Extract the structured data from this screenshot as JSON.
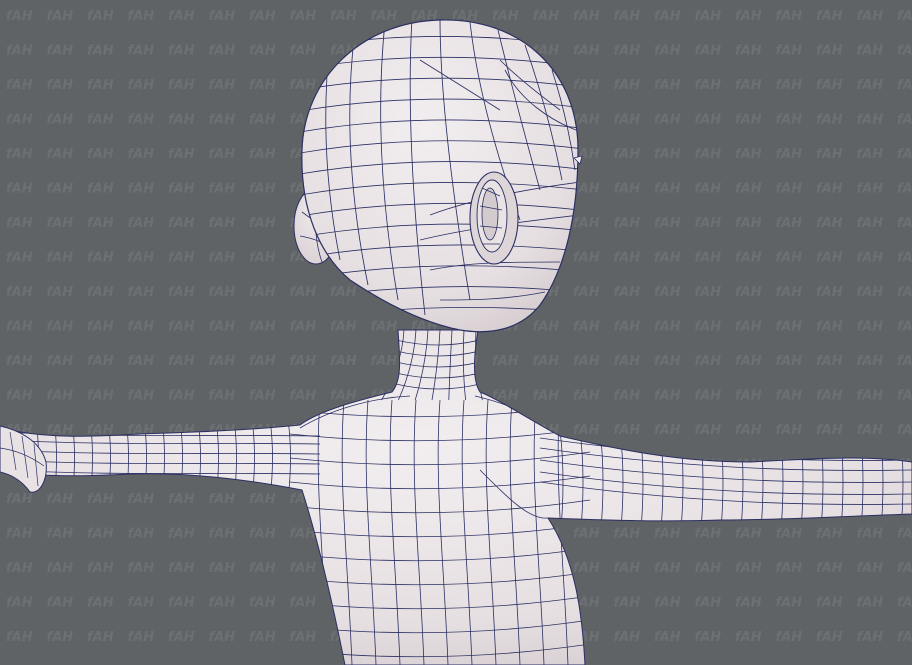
{
  "viewport": {
    "background": "#5f6366",
    "mesh_fill": "#ece6e8",
    "mesh_shade": "#d9d1d4",
    "wire_color": "#2b2f63"
  },
  "model": {
    "subject": "humanoid-base-mesh",
    "pose": "t-pose",
    "display": "shaded-with-wireframe"
  },
  "watermark": {
    "text": "fAH",
    "color": "#6c7073"
  }
}
